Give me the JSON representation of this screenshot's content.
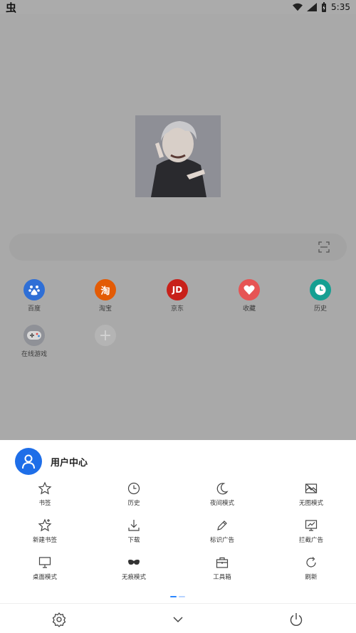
{
  "status_bar": {
    "left_glyph": "虫",
    "time": "5:35",
    "icons": [
      "wifi-icon",
      "signal-icon",
      "battery-icon"
    ]
  },
  "home": {
    "quick_links": [
      {
        "label": "百度",
        "icon": "baidu-icon",
        "color": "#3b78dd",
        "glyph": ""
      },
      {
        "label": "淘宝",
        "icon": "taobao-icon",
        "color": "#ff6a00",
        "glyph": "淘"
      },
      {
        "label": "京东",
        "icon": "jd-icon",
        "color": "#e1251b",
        "glyph": "JD"
      },
      {
        "label": "收藏",
        "icon": "favorites-icon",
        "color": "#ff5a5a",
        "glyph": ""
      },
      {
        "label": "历史",
        "icon": "history-icon",
        "color": "#17b3a3",
        "glyph": ""
      },
      {
        "label": "在线游戏",
        "icon": "gamepad-icon",
        "color": "#9fa2a9",
        "glyph": ""
      },
      {
        "label": "",
        "icon": "add-icon",
        "color": "#b9b9b9",
        "glyph": "+"
      }
    ]
  },
  "sheet": {
    "user_center": "用户中心",
    "menu": [
      {
        "label": "书签",
        "icon": "star-icon"
      },
      {
        "label": "历史",
        "icon": "clock-icon"
      },
      {
        "label": "夜间模式",
        "icon": "moon-icon"
      },
      {
        "label": "无图模式",
        "icon": "no-image-icon"
      },
      {
        "label": "新建书签",
        "icon": "star-plus-icon"
      },
      {
        "label": "下载",
        "icon": "download-icon"
      },
      {
        "label": "标识广告",
        "icon": "pen-icon"
      },
      {
        "label": "拦截广告",
        "icon": "ad-block-icon"
      },
      {
        "label": "桌面模式",
        "icon": "desktop-icon"
      },
      {
        "label": "无痕模式",
        "icon": "mask-icon"
      },
      {
        "label": "工具箱",
        "icon": "toolbox-icon"
      },
      {
        "label": "刷新",
        "icon": "refresh-icon"
      }
    ],
    "bottom": [
      "settings-icon",
      "collapse-icon",
      "power-icon"
    ]
  }
}
